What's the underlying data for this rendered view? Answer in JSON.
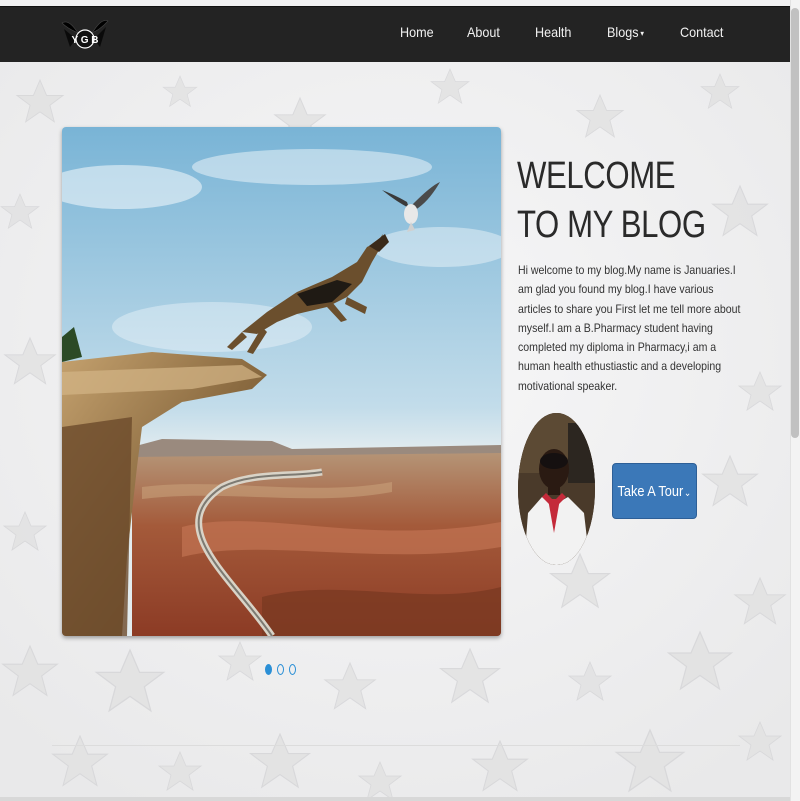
{
  "header": {
    "logo_text": "Y G B",
    "nav": [
      {
        "label": "Home"
      },
      {
        "label": "About"
      },
      {
        "label": "Health"
      },
      {
        "label": "Blogs",
        "caret": "▾"
      },
      {
        "label": "Contact"
      }
    ]
  },
  "hero": {
    "title": "WELCOME TO MY BLOG",
    "text": "Hi welcome to my blog.My name is Januaries.I am glad you found my blog.I have various articles to share you First let me tell more about myself.I am a B.Pharmacy student having completed my diploma in Pharmacy,i am a human health ethustiastic and a developing motivational speaker.",
    "tour_button": "Take A Tour",
    "tour_chevron": "⌄"
  },
  "carousel": {
    "slide_count": 3,
    "active_index": 0
  },
  "colors": {
    "navbar": "#232323",
    "button": "#3b78b8",
    "dot": "#2a8fd6"
  }
}
